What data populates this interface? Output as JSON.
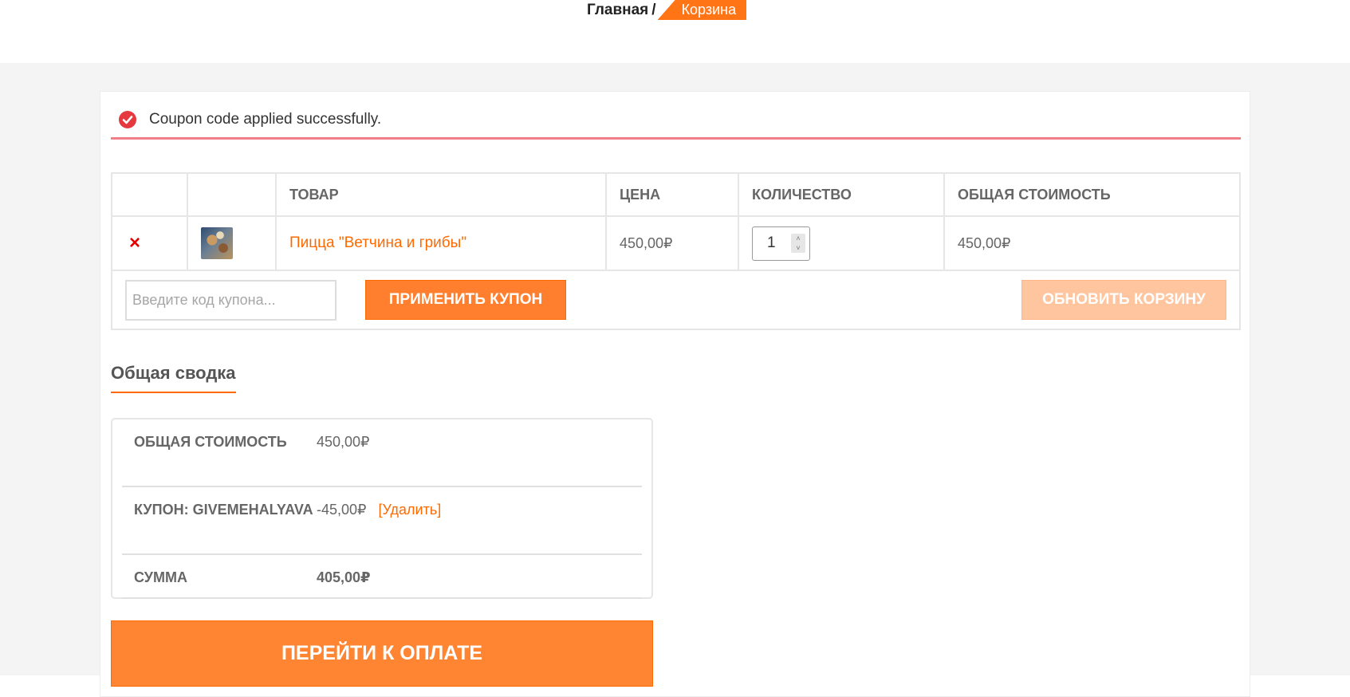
{
  "breadcrumb": {
    "home": "Главная",
    "separator": "/",
    "current": "Корзина"
  },
  "notice": {
    "icon": "check-circle-icon",
    "text": "Coupon code applied successfully."
  },
  "cart": {
    "headers": [
      "",
      "",
      "Товар",
      "Цена",
      "Количество",
      "Общая стоимость"
    ],
    "items": [
      {
        "remove_glyph": "×",
        "thumbnail": "pizza-thumbnail",
        "product": "Пицца \"Ветчина и грибы\"",
        "price": "450,00₽",
        "quantity": "1",
        "subtotal": "450,00₽"
      }
    ],
    "coupon_placeholder": "Введите код купона...",
    "apply_coupon_label": "Применить купон",
    "update_cart_label": "Обновить корзину"
  },
  "summary": {
    "title": "Общая сводка",
    "subtotal_label": "Общая стоимость",
    "subtotal_value": "450,00₽",
    "coupon_label": "Купон: givemehalyava",
    "coupon_value": "-45,00₽",
    "coupon_remove": "[Удалить]",
    "total_label": "Сумма",
    "total_value": "405,00₽",
    "checkout_label": "Перейти к оплате"
  },
  "colors": {
    "accent": "#ff7415",
    "notice_border": "#f07f88",
    "remove": "#e50000"
  }
}
